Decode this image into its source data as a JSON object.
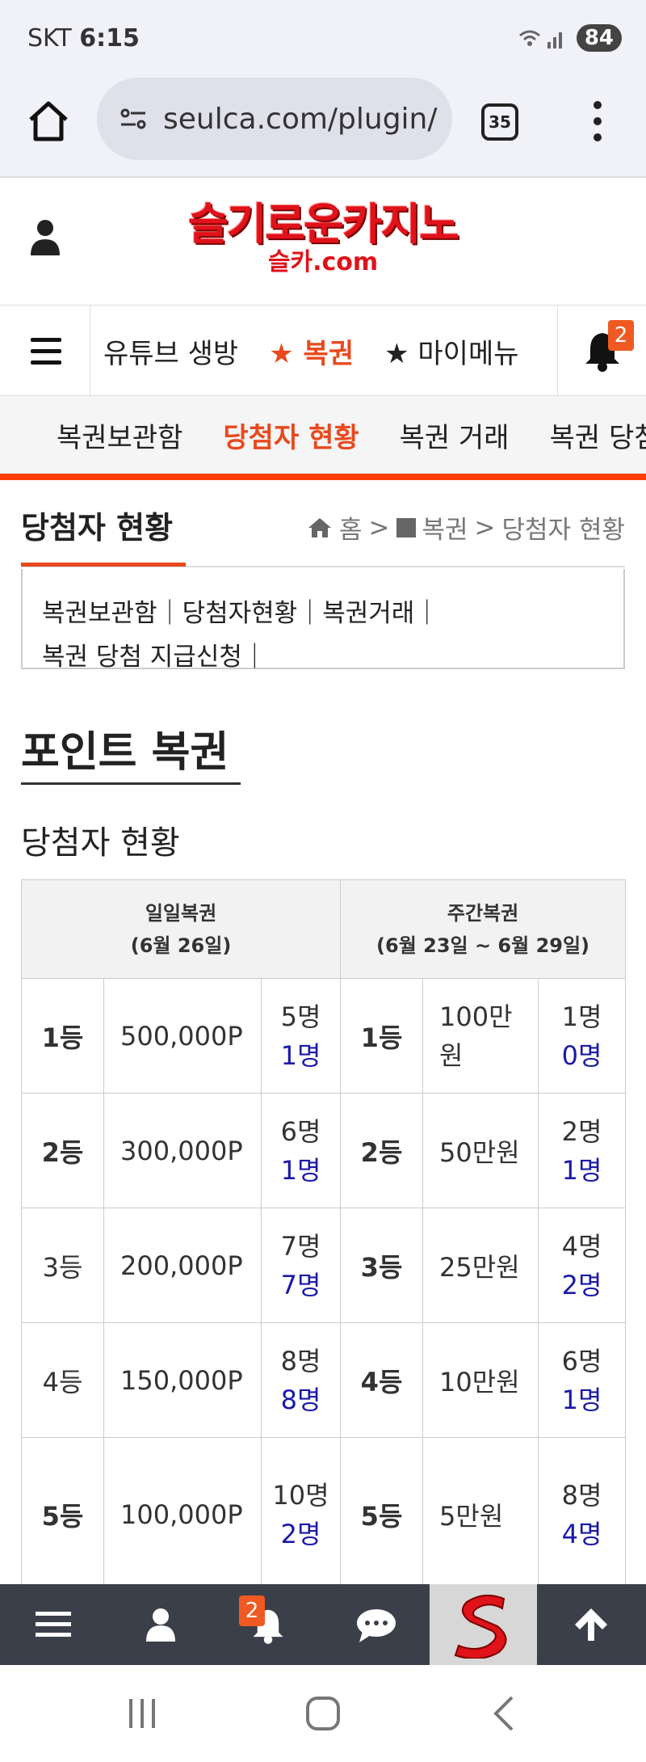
{
  "status": {
    "carrier": "SKT",
    "time": "6:15",
    "battery": "84"
  },
  "browser": {
    "url": "seulca.com/plugin/",
    "tabs": "35"
  },
  "logo": {
    "line1": "슬기로운카지노",
    "line2": "슬카.com"
  },
  "main_nav": {
    "items": [
      "유튜브 생방",
      "★ 복권",
      "★ 마이메뉴"
    ],
    "notification_count": "2"
  },
  "sub_nav": {
    "items": [
      "복권보관함",
      "당첨자 현황",
      "복권 거래",
      "복권 당첨"
    ]
  },
  "page": {
    "title": "당첨자 현황",
    "breadcrumb": {
      "home": "홈",
      "sep": ">",
      "section": "복권",
      "current": "당첨자 현황"
    },
    "links_line1": "복권보관함｜당첨자현황｜복권거래｜",
    "links_line2": "복권 당첨 지급신청｜",
    "section_title": "포인트 복권",
    "subsection_title": "당첨자 현황"
  },
  "table": {
    "daily_header": "일일복권",
    "daily_date": "(6월 26일)",
    "weekly_header": "주간복권",
    "weekly_date": "(6월 23일 ~ 6월 29일)",
    "rows": [
      {
        "d_rank": "1등",
        "d_amt": "500,000P",
        "d_total": "5명",
        "d_win": "1명",
        "w_rank": "1등",
        "w_amt": "100만원",
        "w_total": "1명",
        "w_win": "0명"
      },
      {
        "d_rank": "2등",
        "d_amt": "300,000P",
        "d_total": "6명",
        "d_win": "1명",
        "w_rank": "2등",
        "w_amt": "50만원",
        "w_total": "2명",
        "w_win": "1명"
      },
      {
        "d_rank": "3등",
        "d_amt": "200,000P",
        "d_total": "7명",
        "d_win": "7명",
        "w_rank": "3등",
        "w_amt": "25만원",
        "w_total": "4명",
        "w_win": "2명"
      },
      {
        "d_rank": "4등",
        "d_amt": "150,000P",
        "d_total": "8명",
        "d_win": "8명",
        "w_rank": "4등",
        "w_amt": "10만원",
        "w_total": "6명",
        "w_win": "1명"
      },
      {
        "d_rank": "5등",
        "d_amt": "100,000P",
        "d_total": "10명",
        "d_win": "2명",
        "w_rank": "5등",
        "w_amt": "5만원",
        "w_total": "8명",
        "w_win": "4명"
      }
    ]
  },
  "app_bar": {
    "notification_count": "2"
  },
  "colors": {
    "accent": "#e8491d",
    "winner_blue": "#1a1aaa",
    "appbar": "#3b3f4a"
  }
}
